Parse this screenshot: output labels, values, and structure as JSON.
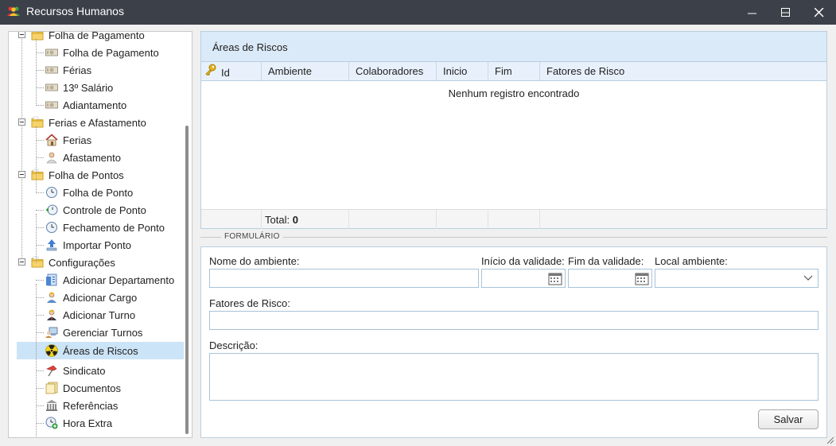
{
  "window": {
    "title": "Recursos Humanos"
  },
  "tree": {
    "nodes": [
      {
        "label": "Folha de Pagamento",
        "level": 0,
        "icon": "folder-icon",
        "expanded": true
      },
      {
        "label": "Folha de Pagamento",
        "level": 1,
        "icon": "money-icon"
      },
      {
        "label": "Férias",
        "level": 1,
        "icon": "money-icon"
      },
      {
        "label": "13º Salário",
        "level": 1,
        "icon": "money-icon"
      },
      {
        "label": "Adiantamento",
        "level": 1,
        "icon": "money-icon"
      },
      {
        "label": "Ferias e Afastamento",
        "level": 0,
        "icon": "folder-icon",
        "expanded": true
      },
      {
        "label": "Ferias",
        "level": 1,
        "icon": "house-icon"
      },
      {
        "label": "Afastamento",
        "level": 1,
        "icon": "person-icon"
      },
      {
        "label": "Folha de Pontos",
        "level": 0,
        "icon": "folder-icon",
        "expanded": true
      },
      {
        "label": "Folha de Ponto",
        "level": 1,
        "icon": "clock-icon"
      },
      {
        "label": "Controle de Ponto",
        "level": 1,
        "icon": "clock-back-icon"
      },
      {
        "label": "Fechamento de Ponto",
        "level": 1,
        "icon": "clock-icon"
      },
      {
        "label": "Importar Ponto",
        "level": 1,
        "icon": "upload-icon"
      },
      {
        "label": "Configurações",
        "level": 0,
        "icon": "folder-icon",
        "expanded": true
      },
      {
        "label": "Adicionar Departamento",
        "level": 1,
        "icon": "department-icon"
      },
      {
        "label": "Adicionar Cargo",
        "level": 1,
        "icon": "user-add-icon"
      },
      {
        "label": "Adicionar Turno",
        "level": 1,
        "icon": "user-tie-icon"
      },
      {
        "label": "Gerenciar Turnos",
        "level": 1,
        "icon": "computer-user-icon"
      },
      {
        "label": "Áreas de Riscos",
        "level": 1,
        "icon": "radiation-icon",
        "selected": true
      },
      {
        "label": "Sindicato",
        "level": 1,
        "icon": "pin-icon"
      },
      {
        "label": "Documentos",
        "level": 1,
        "icon": "documents-icon"
      },
      {
        "label": "Referências",
        "level": 1,
        "icon": "bank-icon"
      },
      {
        "label": "Hora Extra",
        "level": 1,
        "icon": "clock-add-icon"
      }
    ]
  },
  "grid": {
    "title": "Áreas de Riscos",
    "columns": [
      "Id",
      "Ambiente",
      "Colaboradores",
      "Inicio",
      "Fim",
      "Fatores de Risco"
    ],
    "empty_message": "Nenhum registro encontrado",
    "total_label": "Total:",
    "total_value": "0"
  },
  "form": {
    "legend": "FORMULÁRIO",
    "nome_label": "Nome do ambiente:",
    "nome_value": "",
    "inicio_label": "Início da validade:",
    "inicio_value": "",
    "fim_label": "Fim da validade:",
    "fim_value": "",
    "local_label": "Local ambiente:",
    "local_value": "",
    "fatores_label": "Fatores de Risco:",
    "fatores_value": "",
    "descricao_label": "Descrição:",
    "descricao_value": "",
    "save_label": "Salvar"
  },
  "colors": {
    "titlebar": "#3c4049",
    "header_bg": "#dbeaf8",
    "selection": "#cce4f7",
    "border": "#b9cfe0"
  }
}
